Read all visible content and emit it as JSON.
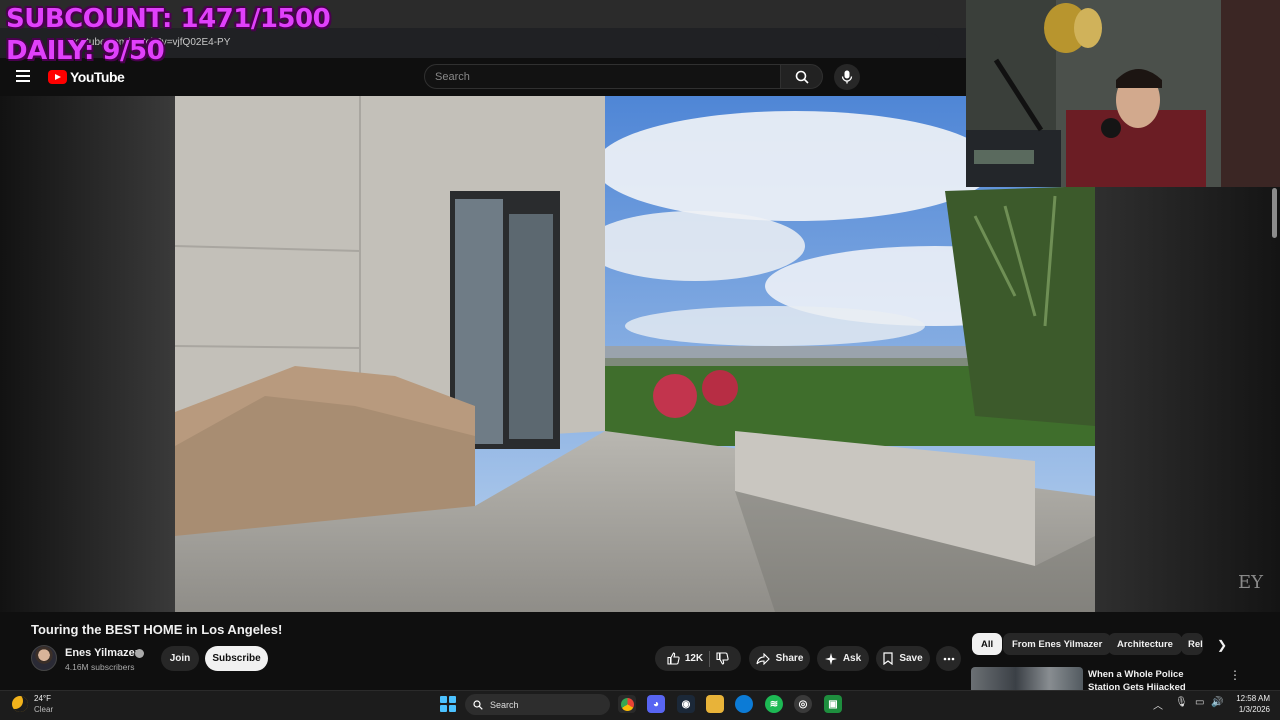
{
  "browser": {
    "url": "youtube.com/watch?v=vjfQ02E4-PY"
  },
  "overlay": {
    "subcount": "SUBCOUNT: 1471/1500",
    "daily": "DAILY: 9/50"
  },
  "header": {
    "logo_text": "YouTube",
    "search_placeholder": "Search"
  },
  "video": {
    "watermark": "EY",
    "title": "Touring the BEST HOME in Los Angeles!"
  },
  "channel": {
    "name": "Enes Yilmazer",
    "subscribers": "4.16M subscribers",
    "join_label": "Join",
    "subscribe_label": "Subscribe"
  },
  "actions": {
    "likes": "12K",
    "share_label": "Share",
    "ask_label": "Ask",
    "save_label": "Save"
  },
  "chips": [
    "All",
    "From Enes Yilmazer",
    "Architecture",
    "Rel"
  ],
  "recommendation": {
    "title": "When a Whole Police Station Gets Hijacked"
  },
  "taskbar": {
    "weather_temp": "24°F",
    "weather_cond": "Clear",
    "search_label": "Search",
    "time": "12:58 AM",
    "date": "1/3/2026"
  },
  "colors": {
    "overlay": "#e040fb",
    "yt_red": "#ff0000",
    "background": "#0f0f0f"
  }
}
